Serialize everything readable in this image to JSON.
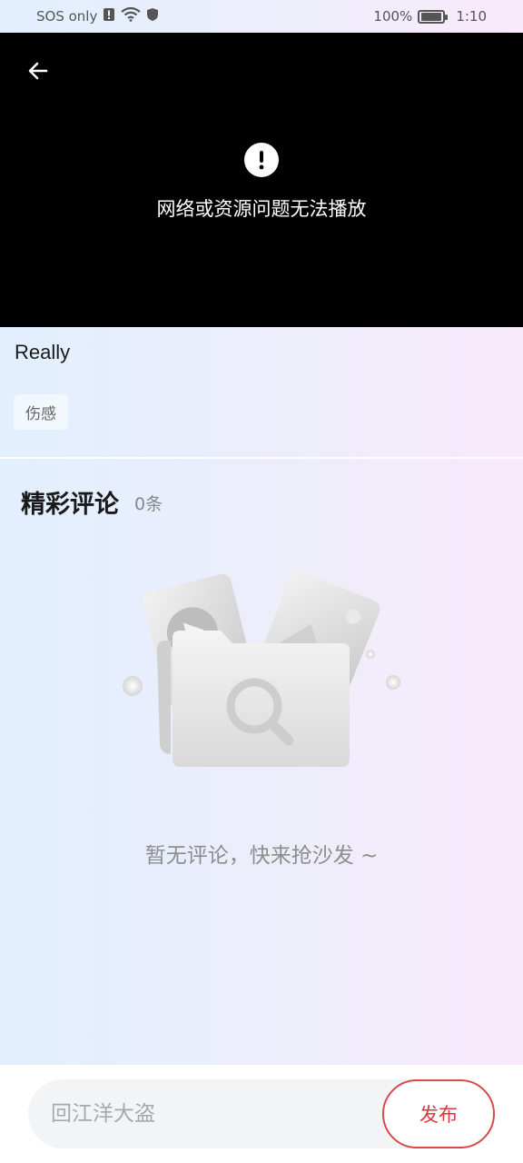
{
  "status_bar": {
    "carrier": "SOS only",
    "battery": "100%",
    "time": "1:10",
    "icons": [
      "alert-sim-icon",
      "wifi-icon",
      "shield-icon",
      "battery-icon"
    ]
  },
  "video": {
    "back_icon": "back-arrow-icon",
    "error_icon": "exclamation-icon",
    "error_message": "网络或资源问题无法播放"
  },
  "info": {
    "title": "Really",
    "tags": [
      "伤感"
    ]
  },
  "comments": {
    "heading": "精彩评论",
    "count": "0条",
    "empty_illustration": "empty-folder-search-illustration",
    "empty_message": "暂无评论，快来抢沙发 ~"
  },
  "reply_bar": {
    "placeholder": "回江洋大盗",
    "value": "",
    "publish_label": "发布"
  },
  "colors": {
    "accent": "#d23c3f",
    "video_bg": "#000000"
  }
}
